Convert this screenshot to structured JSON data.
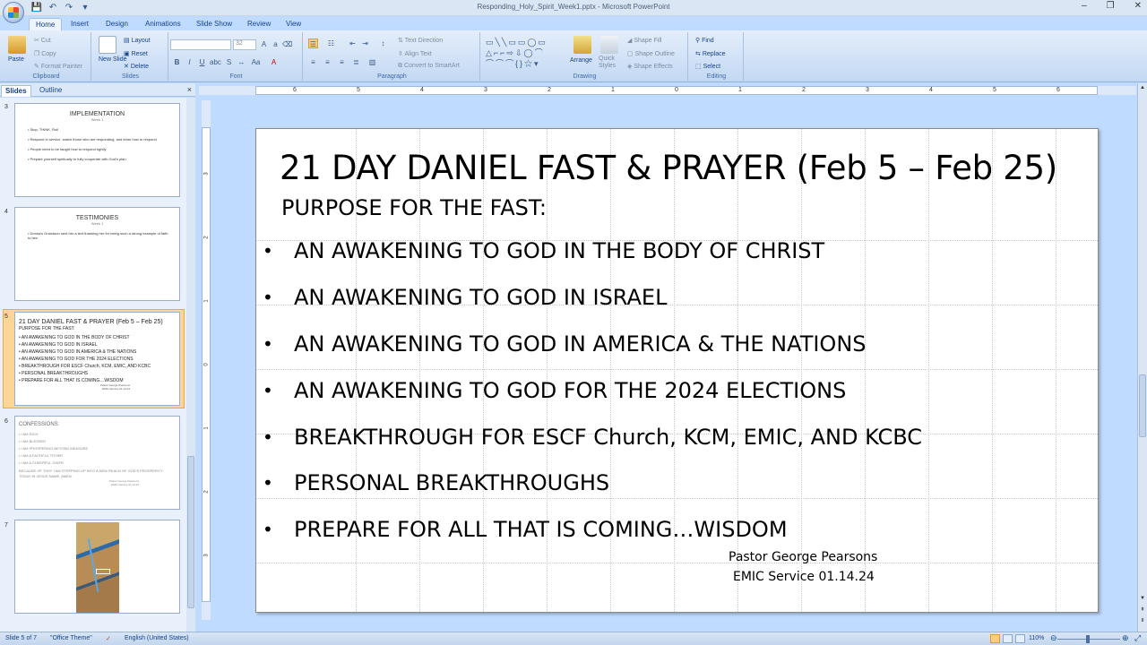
{
  "window": {
    "title": "Responding_Holy_Spirit_Week1.pptx - Microsoft PowerPoint",
    "controls": [
      "–",
      "❐",
      "✕"
    ]
  },
  "qat": [
    "💾",
    "↶",
    "↷",
    "▾"
  ],
  "tabs": [
    "Home",
    "Insert",
    "Design",
    "Animations",
    "Slide Show",
    "Review",
    "View"
  ],
  "ribbon": {
    "clipboard": {
      "label": "Clipboard",
      "paste": "Paste",
      "cut": "Cut",
      "copy": "Copy",
      "format_painter": "Format Painter"
    },
    "slides": {
      "label": "Slides",
      "new_slide": "New Slide",
      "layout": "Layout",
      "reset": "Reset",
      "delete": "Delete"
    },
    "font": {
      "label": "Font",
      "size": "32"
    },
    "paragraph": {
      "label": "Paragraph",
      "text_direction": "Text Direction",
      "align_text": "Align Text",
      "convert_smartart": "Convert to SmartArt"
    },
    "drawing": {
      "label": "Drawing",
      "arrange": "Arrange",
      "quick_styles": "Quick Styles",
      "shape_fill": "Shape Fill",
      "shape_outline": "Shape Outline",
      "shape_effects": "Shape Effects"
    },
    "editing": {
      "label": "Editing",
      "find": "Find",
      "replace": "Replace",
      "select": "Select"
    }
  },
  "pane": {
    "tab_slides": "Slides",
    "tab_outline": "Outline",
    "close": "×"
  },
  "thumbnails": {
    "s3": {
      "num": "3",
      "title": "IMPLEMENTATION",
      "sub": "Week 1",
      "lines": [
        "Stop, THINK, Roll",
        "Respond in service, watch those who are responding, and learn how to respond",
        "People need to be taught how to respond rightly",
        "Prepare yourself spiritually to fully cooperate with God's plan"
      ]
    },
    "s4": {
      "num": "4",
      "title": "TESTIMONIES",
      "sub": "Week 1",
      "lines": [
        "Donna's Grandson sent her a text thanking her for being such a strong example of faith to him"
      ]
    },
    "s5": {
      "num": "5",
      "title": "21 DAY DANIEL FAST & PRAYER  (Feb 5 – Feb 25)",
      "purpose": "PURPOSE FOR THE FAST:",
      "lines": [
        "AN AWAKENING TO GOD IN THE BODY OF CHRIST",
        "AN AWAKENING TO GOD IN ISRAEL",
        "AN AWAKENING TO GOD IN AMERICA & THE NATIONS",
        "AN AWAKENING TO GOD FOR THE 2024 ELECTIONS",
        "BREAKTHROUGH FOR ESCF Church, KCM, EMIC, AND KCBC",
        "PERSONAL BREAKTHROUGHS",
        "PREPARE FOR ALL THAT IS COMING…WISDOM"
      ],
      "sig1": "Pastor George Pearsons",
      "sig2": "EMIC Service 01.14.24"
    },
    "s6": {
      "num": "6",
      "title": "CONFESSIONS:",
      "lines": [
        "I AM RICH",
        "I AM BLESSED",
        "I AM PROSPERING BEYOND MEASURE",
        "I AM A FAITHFUL TITHER",
        "I AM A CHEERFUL GIVER"
      ],
      "body": "BECAUSE OF THIS* I AM STEPPING UP INTO A NEW REALM OF GOD'S PROSPERITY TODAY IN JESUS NAME.  AMEN.",
      "sig1": "Pastor George Pearsons",
      "sig2": "EMIC Service 01.14.24"
    },
    "s7": {
      "num": "7"
    }
  },
  "slide": {
    "title": "21 DAY DANIEL FAST & PRAYER  (Feb 5 – Feb 25)",
    "purpose": "PURPOSE FOR THE FAST:",
    "bullets": [
      "AN AWAKENING TO GOD IN THE BODY OF CHRIST",
      "AN AWAKENING TO GOD IN ISRAEL",
      "AN AWAKENING TO GOD IN AMERICA & THE NATIONS",
      "AN AWAKENING TO GOD FOR THE 2024 ELECTIONS",
      "BREAKTHROUGH FOR ESCF Church, KCM, EMIC, AND KCBC",
      "PERSONAL BREAKTHROUGHS",
      "PREPARE FOR ALL THAT IS COMING…WISDOM"
    ],
    "bullet_char": "•",
    "sig1": "Pastor George Pearsons",
    "sig2": "EMIC Service 01.14.24"
  },
  "ruler": {
    "h_labels": [
      "6",
      "5",
      "4",
      "3",
      "2",
      "1",
      "0",
      "1",
      "2",
      "3",
      "4",
      "5",
      "6"
    ],
    "v_labels": [
      "3",
      "2",
      "1",
      "0",
      "1",
      "2",
      "3"
    ]
  },
  "status": {
    "slide_of": "Slide 5 of 7",
    "theme": "\"Office Theme\"",
    "language": "English (United States)",
    "zoom": "110%"
  }
}
